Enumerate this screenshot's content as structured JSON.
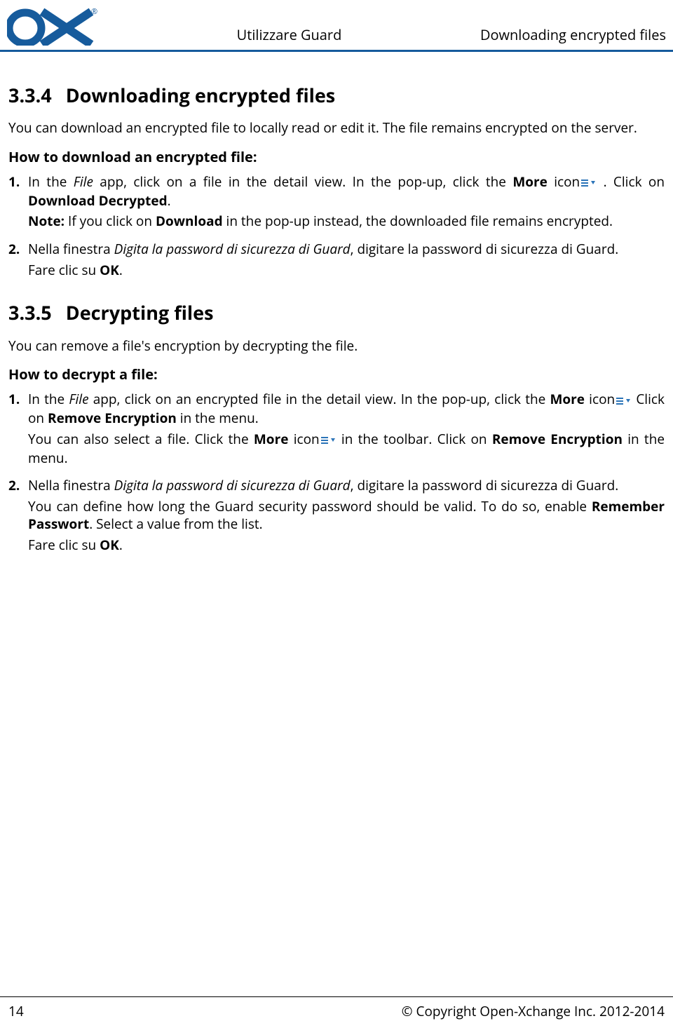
{
  "header": {
    "logo_text": "OX",
    "logo_reg": "®",
    "center": "Utilizzare Guard",
    "right": "Downloading encrypted files"
  },
  "sec334": {
    "number": "3.3.4",
    "title": "Downloading encrypted files",
    "intro": "You can download an encrypted file to locally read or edit it. The file remains encrypted on the server.",
    "howto": "How to download an encrypted file:",
    "steps": [
      {
        "num": "1.",
        "a_pre": "In the ",
        "a_file": "File",
        "a_mid": " app, click on a file in the detail view. In the pop-up, click the ",
        "a_more": "More",
        "a_post": " icon",
        "a_end": " . Click on ",
        "a_dl": "Download Decrypted",
        "a_period": ".",
        "note_label": "Note:",
        "note_mid": " If you click on ",
        "note_dl": "Download",
        "note_end": " in the pop-up instead, the downloaded file remains encrypted."
      },
      {
        "num": "2.",
        "b_pre": "Nella finestra ",
        "b_it": "Digita la password di sicurezza di Guard",
        "b_post": ", digitare la password di sicurezza di Guard.",
        "b2_pre": "Fare clic su ",
        "b2_ok": "OK",
        "b2_end": "."
      }
    ]
  },
  "sec335": {
    "number": "3.3.5",
    "title": "Decrypting files",
    "intro": "You can remove a file's encryption by decrypting the file.",
    "howto": "How to decrypt a file:",
    "steps": [
      {
        "num": "1.",
        "a_pre": "In the ",
        "a_file": "File",
        "a_mid": " app, click on an encrypted file in the detail view. In the pop-up, click the ",
        "a_more": "More",
        "a_post": " icon",
        "a_end2": " Click on ",
        "a_rm": "Remove Encryption",
        "a_end3": " in the menu.",
        "b_pre": "You can also select a file. Click the ",
        "b_more": "More",
        "b_post": " icon",
        "b_mid2": " in the toolbar. Click on ",
        "b_rm": "Remove Encryption",
        "b_end": " in the menu."
      },
      {
        "num": "2.",
        "c_pre": "Nella finestra ",
        "c_it": "Digita la password di sicurezza di Guard",
        "c_post": ", digitare la password di sicurezza di Guard.",
        "d_pre": "You can define how long the Guard security password should be valid. To do so, enable ",
        "d_rem": "Remember Passwort",
        "d_post": ". Select a value from the list.",
        "e_pre": "Fare clic su ",
        "e_ok": "OK",
        "e_end": "."
      }
    ]
  },
  "footer": {
    "page": "14",
    "copyright": "© Copyright Open-Xchange Inc. 2012-2014"
  }
}
